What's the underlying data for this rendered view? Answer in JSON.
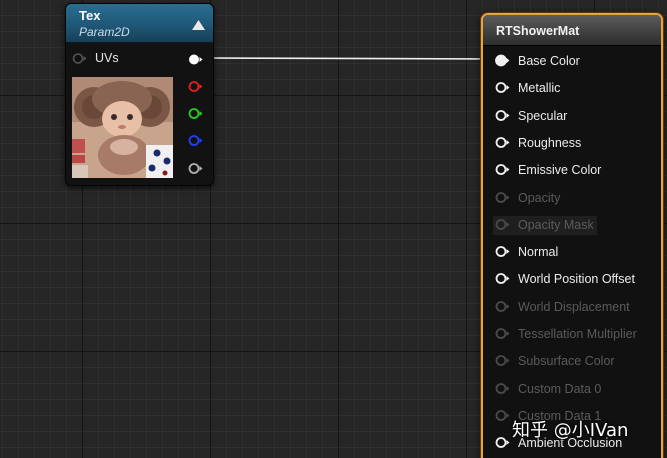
{
  "tex_node": {
    "title": "Tex",
    "subtitle": "Param2D",
    "input_label": "UVs",
    "header_color": "#1f5878",
    "outputs": [
      {
        "name": "rgb",
        "color": "#ffffff"
      },
      {
        "name": "r",
        "color": "#e02020"
      },
      {
        "name": "g",
        "color": "#20d020"
      },
      {
        "name": "b",
        "color": "#2040ff"
      },
      {
        "name": "a",
        "color": "#b0b0b0"
      }
    ]
  },
  "material_node": {
    "title": "RTShowerMat",
    "border_color": "#e8a33a",
    "pins": [
      {
        "label": "Base Color",
        "enabled": true,
        "connected": true
      },
      {
        "label": "Metallic",
        "enabled": true,
        "connected": false
      },
      {
        "label": "Specular",
        "enabled": true,
        "connected": false
      },
      {
        "label": "Roughness",
        "enabled": true,
        "connected": false
      },
      {
        "label": "Emissive Color",
        "enabled": true,
        "connected": false
      },
      {
        "label": "Opacity",
        "enabled": false,
        "connected": false
      },
      {
        "label": "Opacity Mask",
        "enabled": false,
        "connected": false
      },
      {
        "label": "Normal",
        "enabled": true,
        "connected": false
      },
      {
        "label": "World Position Offset",
        "enabled": true,
        "connected": false
      },
      {
        "label": "World Displacement",
        "enabled": false,
        "connected": false
      },
      {
        "label": "Tessellation Multiplier",
        "enabled": false,
        "connected": false
      },
      {
        "label": "Subsurface Color",
        "enabled": false,
        "connected": false
      },
      {
        "label": "Custom Data 0",
        "enabled": false,
        "connected": false
      },
      {
        "label": "Custom Data 1",
        "enabled": false,
        "connected": false
      },
      {
        "label": "Ambient Occlusion",
        "enabled": true,
        "connected": false
      }
    ]
  },
  "watermark": "知乎 @小IVan"
}
